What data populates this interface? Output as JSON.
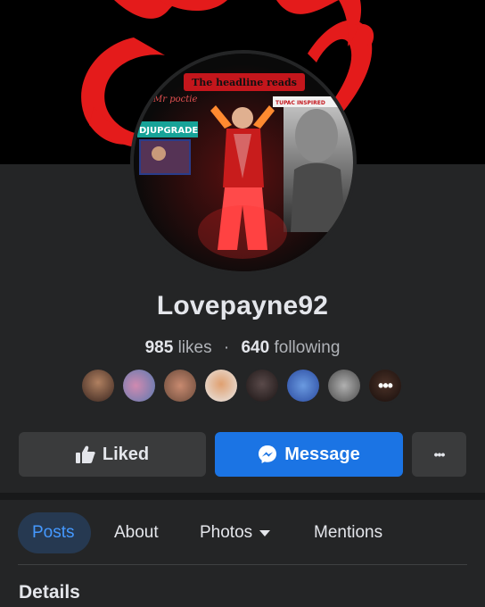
{
  "profile": {
    "name": "Lovepayne92",
    "likes_count": "985",
    "likes_label": "likes",
    "following_count": "640",
    "following_label": "following",
    "separator": "·"
  },
  "cover_photo": {
    "colors": {
      "background": "#000000",
      "accent": "#e41b1b"
    }
  },
  "profile_picture": {
    "headline_banner": "The headline reads",
    "script_text": "Mr poctie",
    "left_badge": "DJUPGRADE",
    "right_badge": "TUPAC INSPIRED",
    "colors": {
      "banner": "#c4161c",
      "badge": "#17a398"
    }
  },
  "friend_avatars": {
    "count_shown": 8,
    "more_glyph": "•••",
    "colors": [
      "#7a5a4a",
      "#c07aa0",
      "#a86a55",
      "#d08a60",
      "#4a3a3a",
      "#5a8ad0",
      "#9a9a9a",
      "#6a4a3a",
      "#5a3a30"
    ]
  },
  "actions": {
    "liked_label": "Liked",
    "message_label": "Message",
    "more_label": "•••"
  },
  "tabs": [
    {
      "label": "Posts",
      "active": true
    },
    {
      "label": "About",
      "active": false
    },
    {
      "label": "Photos",
      "active": false
    },
    {
      "label": "Mentions",
      "active": false
    }
  ],
  "section": {
    "title": "Details"
  },
  "theme": {
    "background": "#242526",
    "primary_blue": "#1b74e4",
    "active_tab_text": "#4599ff",
    "secondary_text": "#b0b3b8"
  }
}
